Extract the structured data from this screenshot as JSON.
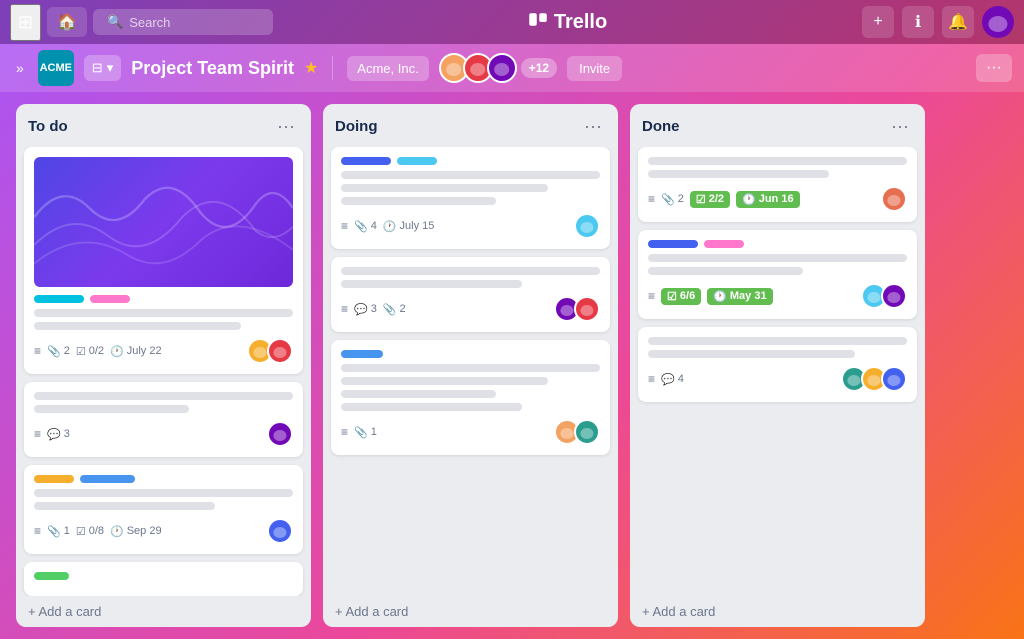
{
  "topNav": {
    "searchPlaceholder": "Search",
    "logoText": "Trello",
    "addLabel": "+",
    "infoLabel": "ℹ",
    "bellLabel": "🔔"
  },
  "boardNav": {
    "workspaceLogoText": "ACME",
    "workspaceDropdown": "▾",
    "boardTitle": "Project Team Spirit",
    "workspaceName": "Acme, Inc.",
    "memberCount": "+12",
    "inviteLabel": "Invite",
    "moreLabel": "···",
    "sidebarToggle": "»"
  },
  "columns": [
    {
      "id": "todo",
      "title": "To do",
      "cards": [
        {
          "hasImage": true,
          "tags": [
            "cyan",
            "pink"
          ],
          "lines": [
            100,
            80
          ],
          "footer": {
            "attachments": "2",
            "checklist": "0/2",
            "date": "July 22",
            "avatars": [
              "av1",
              "av2"
            ]
          }
        },
        {
          "tags": [],
          "lines": [
            100,
            60
          ],
          "footer": {
            "comments": "3",
            "avatars": [
              "av4"
            ]
          }
        },
        {
          "tags": [
            "yellow",
            "blue2"
          ],
          "lines": [
            100,
            70
          ],
          "footer": {
            "attachments": "1",
            "checklist": "0/8",
            "date": "Sep 29",
            "avatars": [
              "av5"
            ]
          }
        },
        {
          "tags": [
            "green"
          ],
          "lines": [],
          "footer": {}
        }
      ]
    },
    {
      "id": "doing",
      "title": "Doing",
      "cards": [
        {
          "tags": [
            "blue-dark",
            "blue"
          ],
          "lines": [
            100,
            80,
            60
          ],
          "footer": {
            "attachments": "4",
            "date": "July 15",
            "avatars": [
              "av3"
            ]
          }
        },
        {
          "tags": [],
          "lines": [
            100,
            70
          ],
          "footer": {
            "comments": "3",
            "attachments": "2",
            "avatars": [
              "av4",
              "av2"
            ]
          }
        },
        {
          "tags": [
            "blue3"
          ],
          "lines": [
            100,
            80,
            60,
            70
          ],
          "footer": {
            "attachments": "1",
            "avatars": [
              "av6",
              "av7"
            ]
          }
        }
      ]
    },
    {
      "id": "done",
      "title": "Done",
      "cards": [
        {
          "tags": [],
          "lines": [
            100,
            70
          ],
          "footer": {
            "attachments": "2",
            "checkBadge": "2/2",
            "dateBadge": "Jun 16",
            "avatars": [
              "av8"
            ]
          }
        },
        {
          "tags": [
            "blue-dark",
            "pink"
          ],
          "lines": [
            100,
            60
          ],
          "footer": {
            "checkBadge": "6/6",
            "dateBadge": "May 31",
            "avatars": [
              "av3",
              "av4"
            ]
          }
        },
        {
          "tags": [],
          "lines": [
            100,
            80
          ],
          "footer": {
            "comments": "4",
            "avatars": [
              "av7",
              "av1",
              "av5"
            ]
          }
        }
      ]
    }
  ],
  "addCardLabel": "+ Add a card"
}
